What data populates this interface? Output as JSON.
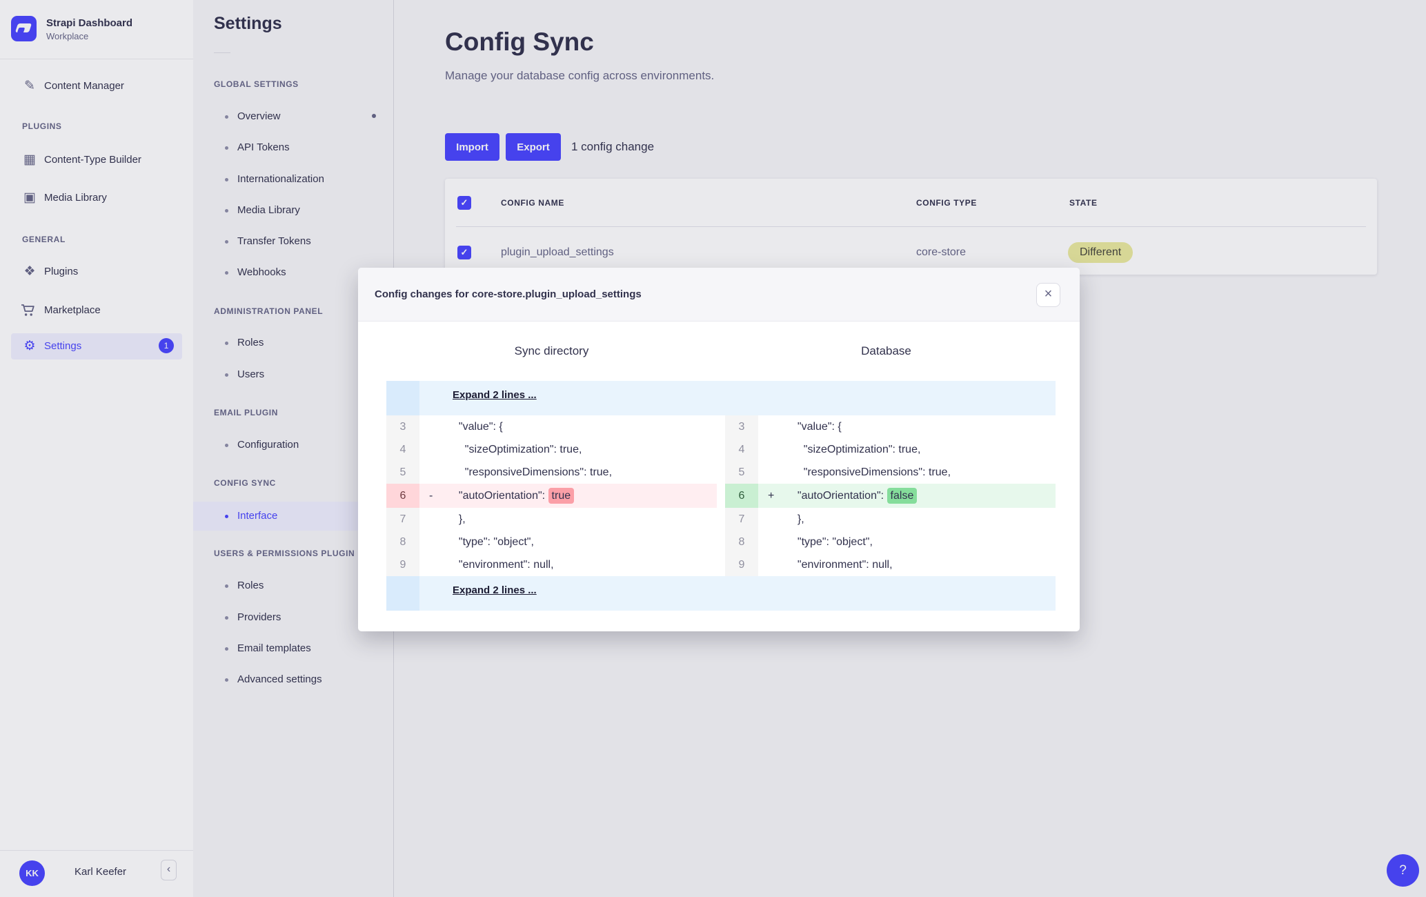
{
  "colors": {
    "accent": "#4945ff",
    "text_dark": "#32324d",
    "text_muted": "#666687",
    "state_badge_bg": "#eaea9f",
    "diff_removed_row": "#ffeef1",
    "diff_removed_token": "#fb9fa7",
    "diff_added_row": "#e7f8ec",
    "diff_added_token": "#85dd9b",
    "expand_row_bg": "#e9f4fd"
  },
  "icons": {
    "pencil": "✎",
    "grid": "▦",
    "picture": "▣",
    "puzzle": "❖",
    "gear": "⚙",
    "check": "✓",
    "chevron_left": "‹",
    "close": "×",
    "help": "?"
  },
  "sidebar": {
    "brand_title": "Strapi Dashboard",
    "brand_subtitle": "Workplace",
    "content_manager": "Content Manager",
    "plugins_section": "PLUGINS",
    "content_type_builder": "Content-Type Builder",
    "media_library": "Media Library",
    "general_section": "GENERAL",
    "plugins": "Plugins",
    "marketplace": "Marketplace",
    "settings": "Settings",
    "settings_badge": "1",
    "user_initials": "KK",
    "user_name": "Karl Keefer"
  },
  "settings_nav": {
    "title": "Settings",
    "sections": [
      {
        "label": "GLOBAL SETTINGS",
        "items": [
          "Overview",
          "API Tokens",
          "Internationalization",
          "Media Library",
          "Transfer Tokens",
          "Webhooks"
        ]
      },
      {
        "label": "ADMINISTRATION PANEL",
        "items": [
          "Roles",
          "Users"
        ]
      },
      {
        "label": "EMAIL PLUGIN",
        "items": [
          "Configuration"
        ]
      },
      {
        "label": "CONFIG SYNC",
        "items": [
          "Interface"
        ]
      },
      {
        "label": "USERS & PERMISSIONS PLUGIN",
        "items": [
          "Roles",
          "Providers",
          "Email templates",
          "Advanced settings"
        ]
      }
    ]
  },
  "content": {
    "title": "Config Sync",
    "subtitle": "Manage your database config across environments.",
    "import_label": "Import",
    "export_label": "Export",
    "changes_text": "1 config change"
  },
  "table": {
    "col_name": "CONFIG NAME",
    "col_type": "CONFIG TYPE",
    "col_state": "STATE",
    "row": {
      "name": "plugin_upload_settings",
      "type": "core-store",
      "state": "Different"
    }
  },
  "modal": {
    "title": "Config changes for core-store.plugin_upload_settings",
    "left_header": "Sync directory",
    "right_header": "Database",
    "expand_top": "Expand 2 lines ...",
    "expand_bottom": "Expand 2 lines ...",
    "diff": {
      "rows": [
        {
          "n": "3",
          "t": "  \"value\": {"
        },
        {
          "n": "4",
          "t": "    \"sizeOptimization\": true,"
        },
        {
          "n": "5",
          "t": "    \"responsiveDimensions\": true,"
        },
        {
          "n": "7",
          "t": "  },"
        },
        {
          "n": "8",
          "t": "  \"type\": \"object\","
        },
        {
          "n": "9",
          "t": "  \"environment\": null,"
        }
      ],
      "changed": {
        "n": "6",
        "left": {
          "marker": "-",
          "code": "  \"autoOrientation\": ",
          "token": "true"
        },
        "right": {
          "marker": "+",
          "code": "  \"autoOrientation\": ",
          "token": "false"
        }
      }
    }
  }
}
